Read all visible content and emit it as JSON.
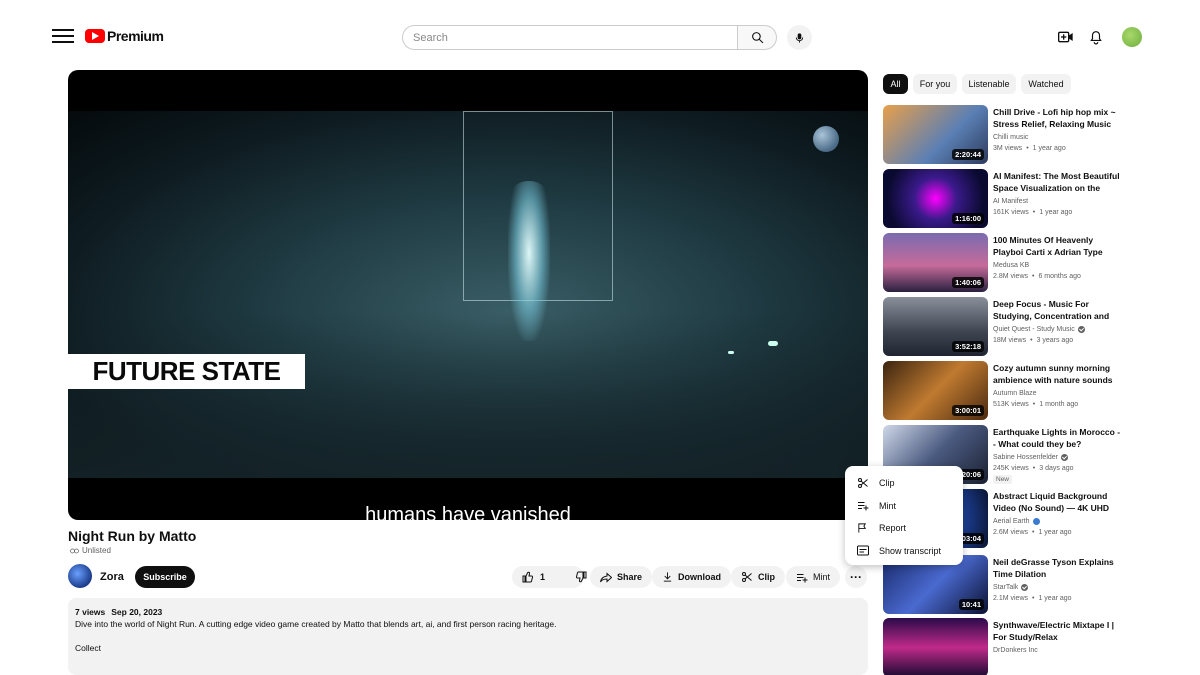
{
  "masthead": {
    "logo_text": "Premium",
    "search_placeholder": "Search"
  },
  "player": {
    "banner_text": "FUTURE STATE",
    "caption": "humans have vanished"
  },
  "video": {
    "title": "Night Run by Matto",
    "visibility": "Unlisted",
    "channel": "Zora",
    "subscribe_label": "Subscribe",
    "like_count": "1",
    "share_label": "Share",
    "download_label": "Download",
    "clip_label": "Clip",
    "mint_label": "Mint",
    "views": "7 views",
    "date": "Sep 20, 2023",
    "description": "Dive into the world of Night Run.  A cutting edge video game created by Matto that blends art, ai, and first person racing heritage.",
    "description_more": "Collect"
  },
  "menu": {
    "items": [
      {
        "label": "Clip",
        "icon": "scissors-icon"
      },
      {
        "label": "Mint",
        "icon": "playlist-add-icon"
      },
      {
        "label": "Report",
        "icon": "flag-icon"
      },
      {
        "label": "Show transcript",
        "icon": "transcript-icon"
      }
    ]
  },
  "chips": [
    "All",
    "For you",
    "Listenable",
    "Watched"
  ],
  "recommendations": [
    {
      "title": "Chill Drive - Lofi hip hop mix ~ Stress Relief, Relaxing Music",
      "channel": "Chilli music",
      "views": "3M views",
      "age": "1 year ago",
      "duration": "2:20:44",
      "verified": false,
      "new": false
    },
    {
      "title": "AI Manifest: The Most Beautiful Space Visualization on the",
      "channel": "AI Manifest",
      "views": "161K views",
      "age": "1 year ago",
      "duration": "1:16:00",
      "verified": false,
      "new": false
    },
    {
      "title": "100 Minutes Of Heavenly Playboi Carti x Adrian Type",
      "channel": "Medusa KB",
      "views": "2.8M views",
      "age": "6 months ago",
      "duration": "1:40:06",
      "verified": false,
      "new": false
    },
    {
      "title": "Deep Focus - Music For Studying, Concentration and",
      "channel": "Quiet Quest - Study Music",
      "views": "18M views",
      "age": "3 years ago",
      "duration": "3:52:18",
      "verified": true,
      "new": false
    },
    {
      "title": "Cozy autumn sunny morning ambience with nature sounds",
      "channel": "Autumn Blaze",
      "views": "513K views",
      "age": "1 month ago",
      "duration": "3:00:01",
      "verified": false,
      "new": false
    },
    {
      "title": "Earthquake Lights in Morocco -- What could they be?",
      "channel": "Sabine Hossenfelder",
      "views": "245K views",
      "age": "3 days ago",
      "duration": "20:06",
      "verified": true,
      "new": true,
      "new_label": "New"
    },
    {
      "title": "Abstract Liquid Background Video (No Sound) — 4K UHD",
      "channel": "Aerial Earth",
      "views": "2.6M views",
      "age": "1 year ago",
      "duration": "3:03:04",
      "verified": false,
      "new": false
    },
    {
      "title": "Neil deGrasse Tyson Explains Time Dilation",
      "channel": "StarTalk",
      "views": "2.1M views",
      "age": "1 year ago",
      "duration": "10:41",
      "verified": true,
      "new": false
    },
    {
      "title": "Synthwave/Electric Mixtape I | For Study/Relax",
      "channel": "DrDonkers Inc",
      "views": "",
      "age": "",
      "duration": "",
      "verified": false,
      "new": false
    }
  ],
  "colors": {
    "brand_red": "#ff0000",
    "text_primary": "#0f0f0f",
    "text_secondary": "#606060",
    "chip_bg": "#f2f2f2"
  }
}
